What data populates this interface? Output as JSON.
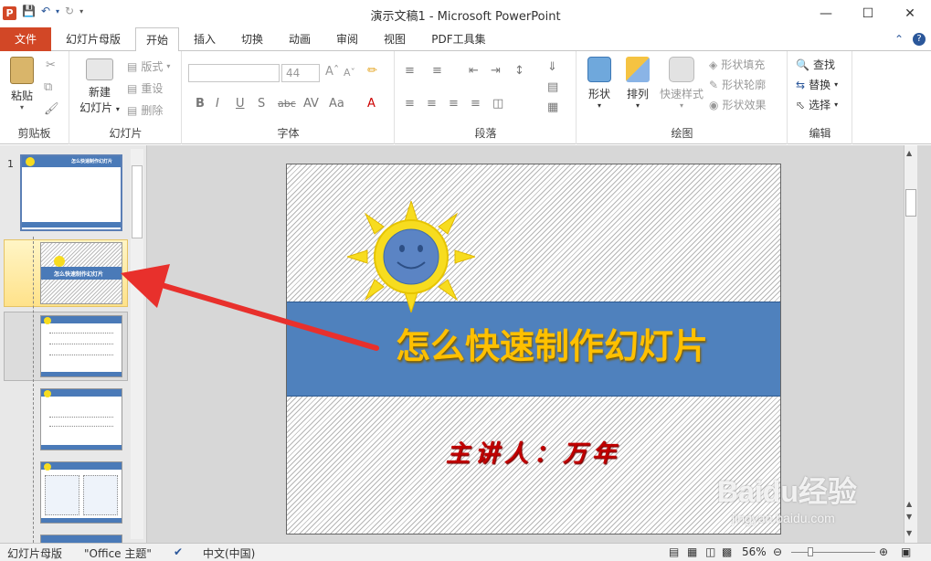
{
  "window": {
    "title": "演示文稿1 - Microsoft PowerPoint",
    "app_logo": "P"
  },
  "window_controls": {
    "minimize": "—",
    "maximize": "☐",
    "close": "✕"
  },
  "tabs": [
    {
      "label": "文件"
    },
    {
      "label": "幻灯片母版"
    },
    {
      "label": "开始"
    },
    {
      "label": "插入"
    },
    {
      "label": "切换"
    },
    {
      "label": "动画"
    },
    {
      "label": "审阅"
    },
    {
      "label": "视图"
    },
    {
      "label": "PDF工具集"
    }
  ],
  "ribbon": {
    "clipboard": {
      "label": "剪贴板",
      "paste": "粘贴"
    },
    "slides": {
      "label": "幻灯片",
      "new_slide_line1": "新建",
      "new_slide_line2": "幻灯片",
      "layout": "版式",
      "reset": "重设",
      "delete": "删除"
    },
    "font": {
      "label": "字体",
      "font_name": "",
      "font_size": "44"
    },
    "paragraph": {
      "label": "段落"
    },
    "drawing": {
      "label": "绘图",
      "shapes": "形状",
      "arrange": "排列",
      "quick_styles": "快速样式",
      "shape_fill": "形状填充",
      "shape_outline": "形状轮廓",
      "shape_effects": "形状效果"
    },
    "editing": {
      "label": "编辑",
      "find": "查找",
      "replace": "替换",
      "select": "选择"
    }
  },
  "thumbnails": {
    "first_number": "1",
    "master_title": "怎么快速制作幻灯片"
  },
  "slide": {
    "title": "怎么快速制作幻灯片",
    "subtitle": "主讲人：万年"
  },
  "status": {
    "view": "幻灯片母版",
    "theme": "\"Office 主题\"",
    "language": "中文(中国)",
    "zoom": "56%"
  },
  "watermark": {
    "main": "Baidu经验",
    "sub": "jingyan.baidu.com"
  },
  "colors": {
    "file_tab": "#d24726",
    "slide_band": "#4f81bd",
    "title": "#ffc000",
    "subtitle": "#c00000",
    "arrow": "#e8302c",
    "sun": "#f7dc1f"
  }
}
